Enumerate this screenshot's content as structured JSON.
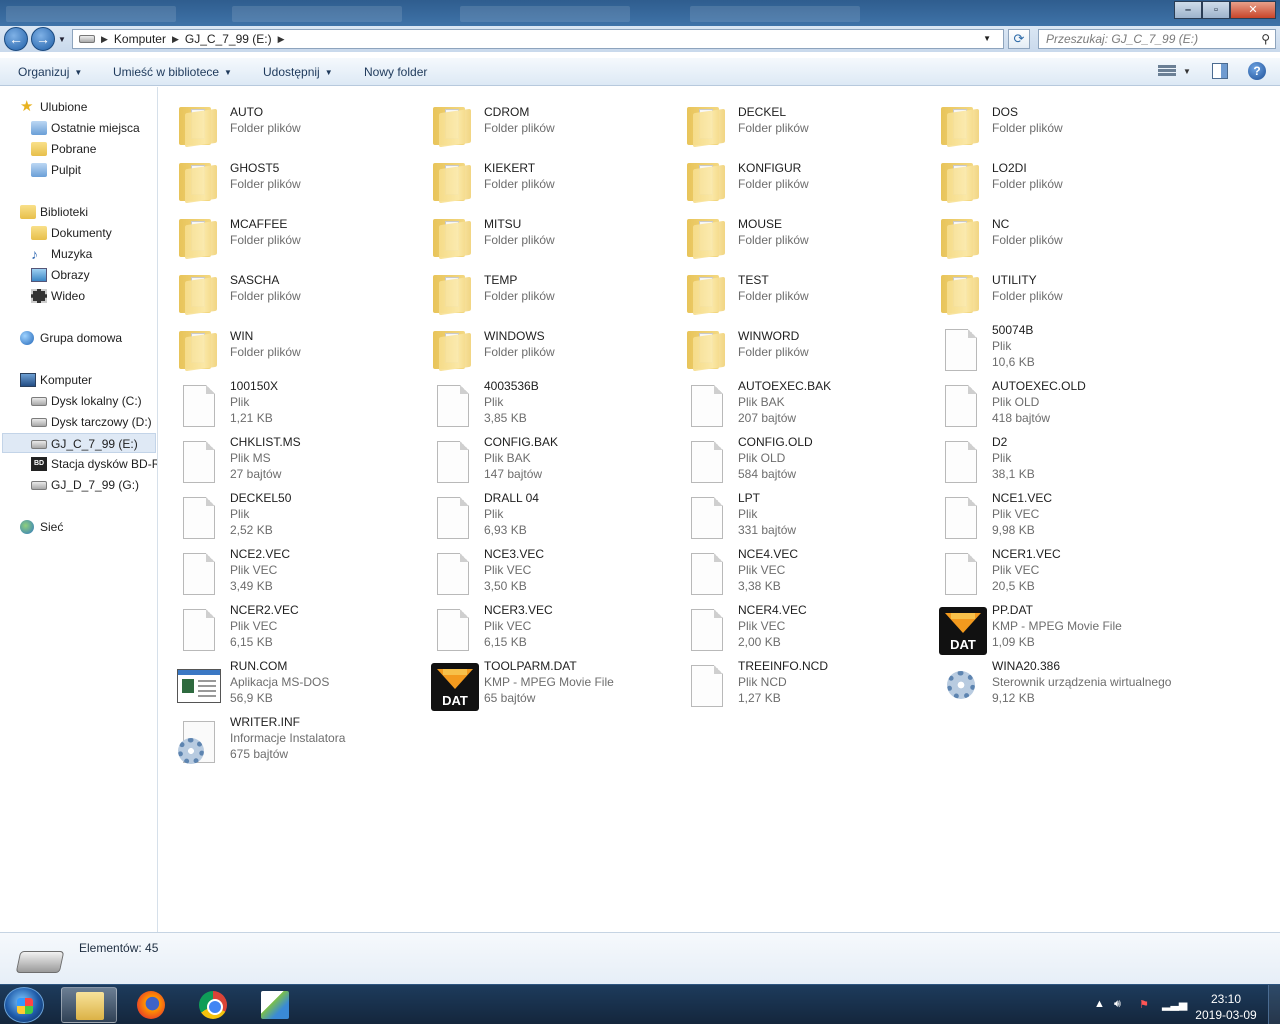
{
  "address": {
    "crumbs": [
      "Komputer",
      "GJ_C_7_99 (E:)"
    ],
    "search_placeholder": "Przeszukaj: GJ_C_7_99 (E:)"
  },
  "toolbar": {
    "organize": "Organizuj",
    "include_library": "Umieść w bibliotece",
    "share": "Udostępnij",
    "new_folder": "Nowy folder"
  },
  "nav": {
    "favorites": "Ulubione",
    "recent": "Ostatnie miejsca",
    "downloads": "Pobrane",
    "desktop": "Pulpit",
    "libraries": "Biblioteki",
    "documents": "Dokumenty",
    "music": "Muzyka",
    "pictures": "Obrazy",
    "videos": "Wideo",
    "homegroup": "Grupa domowa",
    "computer": "Komputer",
    "drive_c": "Dysk lokalny (C:)",
    "drive_d": "Dysk tarczowy (D:)",
    "drive_e": "GJ_C_7_99 (E:)",
    "drive_bd": "Stacja dysków BD-R",
    "drive_g": "GJ_D_7_99 (G:)",
    "network": "Sieć"
  },
  "items": [
    {
      "name": "AUTO",
      "type": "Folder plików",
      "size": "",
      "icon": "folder"
    },
    {
      "name": "CDROM",
      "type": "Folder plików",
      "size": "",
      "icon": "folder"
    },
    {
      "name": "DECKEL",
      "type": "Folder plików",
      "size": "",
      "icon": "folder"
    },
    {
      "name": "DOS",
      "type": "Folder plików",
      "size": "",
      "icon": "folder"
    },
    {
      "name": "GHOST5",
      "type": "Folder plików",
      "size": "",
      "icon": "folder"
    },
    {
      "name": "KIEKERT",
      "type": "Folder plików",
      "size": "",
      "icon": "folder"
    },
    {
      "name": "KONFIGUR",
      "type": "Folder plików",
      "size": "",
      "icon": "folder"
    },
    {
      "name": "LO2DI",
      "type": "Folder plików",
      "size": "",
      "icon": "folder"
    },
    {
      "name": "MCAFFEE",
      "type": "Folder plików",
      "size": "",
      "icon": "folder"
    },
    {
      "name": "MITSU",
      "type": "Folder plików",
      "size": "",
      "icon": "folder"
    },
    {
      "name": "MOUSE",
      "type": "Folder plików",
      "size": "",
      "icon": "folder"
    },
    {
      "name": "NC",
      "type": "Folder plików",
      "size": "",
      "icon": "folder"
    },
    {
      "name": "SASCHA",
      "type": "Folder plików",
      "size": "",
      "icon": "folder"
    },
    {
      "name": "TEMP",
      "type": "Folder plików",
      "size": "",
      "icon": "folder"
    },
    {
      "name": "TEST",
      "type": "Folder plików",
      "size": "",
      "icon": "folder"
    },
    {
      "name": "UTILITY",
      "type": "Folder plików",
      "size": "",
      "icon": "folder"
    },
    {
      "name": "WIN",
      "type": "Folder plików",
      "size": "",
      "icon": "folder"
    },
    {
      "name": "WINDOWS",
      "type": "Folder plików",
      "size": "",
      "icon": "folder"
    },
    {
      "name": "WINWORD",
      "type": "Folder plików",
      "size": "",
      "icon": "folder"
    },
    {
      "name": "50074B",
      "type": "Plik",
      "size": "10,6 KB",
      "icon": "file"
    },
    {
      "name": "100150X",
      "type": "Plik",
      "size": "1,21 KB",
      "icon": "file"
    },
    {
      "name": "4003536B",
      "type": "Plik",
      "size": "3,85 KB",
      "icon": "file"
    },
    {
      "name": "AUTOEXEC.BAK",
      "type": "Plik BAK",
      "size": "207 bajtów",
      "icon": "file"
    },
    {
      "name": "AUTOEXEC.OLD",
      "type": "Plik OLD",
      "size": "418 bajtów",
      "icon": "file"
    },
    {
      "name": "CHKLIST.MS",
      "type": "Plik MS",
      "size": "27 bajtów",
      "icon": "file"
    },
    {
      "name": "CONFIG.BAK",
      "type": "Plik BAK",
      "size": "147 bajtów",
      "icon": "file"
    },
    {
      "name": "CONFIG.OLD",
      "type": "Plik OLD",
      "size": "584 bajtów",
      "icon": "file"
    },
    {
      "name": "D2",
      "type": "Plik",
      "size": "38,1 KB",
      "icon": "file"
    },
    {
      "name": "DECKEL50",
      "type": "Plik",
      "size": "2,52 KB",
      "icon": "file"
    },
    {
      "name": "DRALL 04",
      "type": "Plik",
      "size": "6,93 KB",
      "icon": "file"
    },
    {
      "name": "LPT",
      "type": "Plik",
      "size": "331 bajtów",
      "icon": "file"
    },
    {
      "name": "NCE1.VEC",
      "type": "Plik VEC",
      "size": "9,98 KB",
      "icon": "file"
    },
    {
      "name": "NCE2.VEC",
      "type": "Plik VEC",
      "size": "3,49 KB",
      "icon": "file"
    },
    {
      "name": "NCE3.VEC",
      "type": "Plik VEC",
      "size": "3,50 KB",
      "icon": "file"
    },
    {
      "name": "NCE4.VEC",
      "type": "Plik VEC",
      "size": "3,38 KB",
      "icon": "file"
    },
    {
      "name": "NCER1.VEC",
      "type": "Plik VEC",
      "size": "20,5 KB",
      "icon": "file"
    },
    {
      "name": "NCER2.VEC",
      "type": "Plik VEC",
      "size": "6,15 KB",
      "icon": "file"
    },
    {
      "name": "NCER3.VEC",
      "type": "Plik VEC",
      "size": "6,15 KB",
      "icon": "file"
    },
    {
      "name": "NCER4.VEC",
      "type": "Plik VEC",
      "size": "2,00 KB",
      "icon": "file"
    },
    {
      "name": "PP.DAT",
      "type": "KMP - MPEG Movie File",
      "size": "1,09 KB",
      "icon": "dat"
    },
    {
      "name": "RUN.COM",
      "type": "Aplikacja MS-DOS",
      "size": "56,9 KB",
      "icon": "exe"
    },
    {
      "name": "TOOLPARM.DAT",
      "type": "KMP - MPEG Movie File",
      "size": "65 bajtów",
      "icon": "dat"
    },
    {
      "name": "TREEINFO.NCD",
      "type": "Plik NCD",
      "size": "1,27 KB",
      "icon": "file"
    },
    {
      "name": "WINA20.386",
      "type": "Sterownik urządzenia wirtualnego",
      "size": "9,12 KB",
      "icon": "gear"
    },
    {
      "name": "WRITER.INF",
      "type": "Informacje Instalatora",
      "size": "675 bajtów",
      "icon": "docgear"
    }
  ],
  "status": {
    "count": "Elementów: 45"
  },
  "taskbar": {
    "time": "23:10",
    "date": "2019-03-09"
  }
}
